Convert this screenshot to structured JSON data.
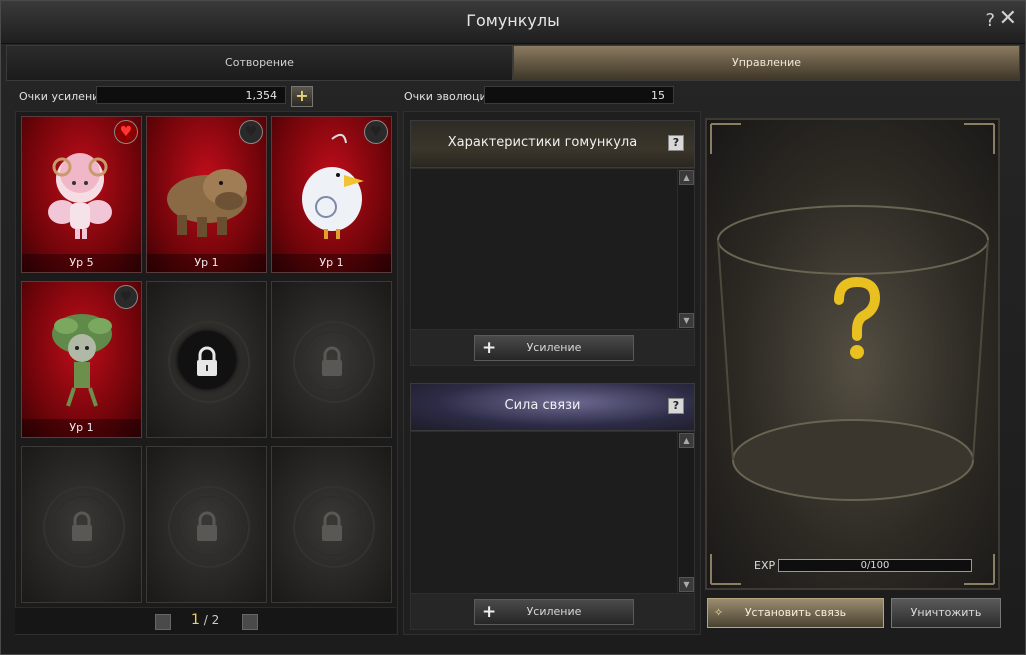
{
  "window": {
    "title": "Гомункулы"
  },
  "tabs": [
    {
      "label": "Сотворение",
      "active": false
    },
    {
      "label": "Управление",
      "active": true
    }
  ],
  "points": {
    "enhance_label": "Очки усиления",
    "enhance_value": "1,354",
    "evolution_label": "Очки эволюции",
    "evolution_value": "15"
  },
  "homunculi": [
    {
      "level": "Ур 5",
      "favorite": true,
      "state": "owned"
    },
    {
      "level": "Ур 1",
      "favorite": false,
      "state": "owned"
    },
    {
      "level": "Ур 1",
      "favorite": false,
      "state": "owned"
    },
    {
      "level": "Ур 1",
      "favorite": false,
      "state": "owned"
    },
    {
      "state": "locked-next"
    },
    {
      "state": "locked"
    },
    {
      "state": "locked"
    },
    {
      "state": "locked"
    },
    {
      "state": "locked"
    }
  ],
  "pager": {
    "current": "1",
    "total": "/ 2"
  },
  "stats_section": {
    "title": "Характеристики гомункула",
    "button": "Усиление"
  },
  "bond_section": {
    "title": "Сила связи",
    "button": "Усиление"
  },
  "exp": {
    "label": "EXP",
    "value": "0/100"
  },
  "actions": {
    "link": "Установить связь",
    "destroy": "Уничтожить"
  },
  "colors": {
    "accent_gold": "#e8c020",
    "card_red": "#b0101a"
  }
}
